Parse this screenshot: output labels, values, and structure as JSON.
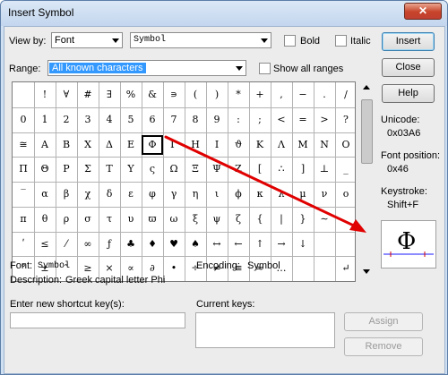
{
  "window": {
    "title": "Insert Symbol",
    "close_glyph": "✕"
  },
  "view_by": {
    "label": "View by:",
    "value": "Font",
    "font_value": "Symbol"
  },
  "bold": {
    "label": "Bold",
    "checked": false
  },
  "italic": {
    "label": "Italic",
    "checked": false
  },
  "range": {
    "label": "Range:",
    "value": "All known characters"
  },
  "show_all_ranges": {
    "label": "Show all ranges",
    "checked": false
  },
  "buttons": {
    "insert": "Insert",
    "close": "Close",
    "help": "Help",
    "assign": "Assign",
    "remove": "Remove"
  },
  "grid": {
    "rows": [
      [
        "",
        "!",
        "∀",
        "#",
        "∃",
        "%",
        "&",
        "∍",
        "(",
        ")",
        "*",
        "+",
        ",",
        "−",
        ".",
        "/"
      ],
      [
        "0",
        "1",
        "2",
        "3",
        "4",
        "5",
        "6",
        "7",
        "8",
        "9",
        ":",
        ";",
        "<",
        "=",
        ">",
        "?"
      ],
      [
        "≅",
        "Α",
        "Β",
        "Χ",
        "Δ",
        "Ε",
        "Φ",
        "Γ",
        "Η",
        "Ι",
        "ϑ",
        "Κ",
        "Λ",
        "Μ",
        "Ν",
        "Ο"
      ],
      [
        "Π",
        "Θ",
        "Ρ",
        "Σ",
        "Τ",
        "Υ",
        "ς",
        "Ω",
        "Ξ",
        "Ψ",
        "Ζ",
        "[",
        "∴",
        "]",
        "⊥",
        "_"
      ],
      [
        "‾",
        "α",
        "β",
        "χ",
        "δ",
        "ε",
        "φ",
        "γ",
        "η",
        "ι",
        "ϕ",
        "κ",
        "λ",
        "μ",
        "ν",
        "ο"
      ],
      [
        "π",
        "θ",
        "ρ",
        "σ",
        "τ",
        "υ",
        "ϖ",
        "ω",
        "ξ",
        "ψ",
        "ζ",
        "{",
        "|",
        "}",
        "∼",
        ""
      ],
      [
        "ʹ",
        "≤",
        "⁄",
        "∞",
        "ƒ",
        "♣",
        "♦",
        "♥",
        "♠",
        "↔",
        "←",
        "↑",
        "→",
        "↓",
        "",
        ""
      ],
      [
        "°",
        "±",
        "″",
        "≥",
        "×",
        "∝",
        "∂",
        "•",
        "÷",
        "≠",
        "≡",
        "≈",
        "…",
        "",
        "",
        "↵"
      ]
    ],
    "selected": {
      "row": 2,
      "col": 6
    }
  },
  "unicode": {
    "label": "Unicode:",
    "value": "0x03A6"
  },
  "font_position": {
    "label": "Font position:",
    "value": "0x46"
  },
  "keystroke": {
    "label": "Keystroke:",
    "value": "Shift+F"
  },
  "preview": {
    "char": "Φ"
  },
  "font_info": {
    "label": "Font:",
    "value": "Symbol"
  },
  "encoding": {
    "label": "Encoding:",
    "value": "Symbol"
  },
  "description": {
    "label": "Description:",
    "value": "Greek capital letter Phi"
  },
  "shortcut": {
    "label": "Enter new shortcut key(s):",
    "value": ""
  },
  "current_keys": {
    "label": "Current keys:"
  },
  "colors": {
    "arrow": "#e00000",
    "title_bg": "#cfe0f2",
    "close_btn": "#c7432a"
  }
}
